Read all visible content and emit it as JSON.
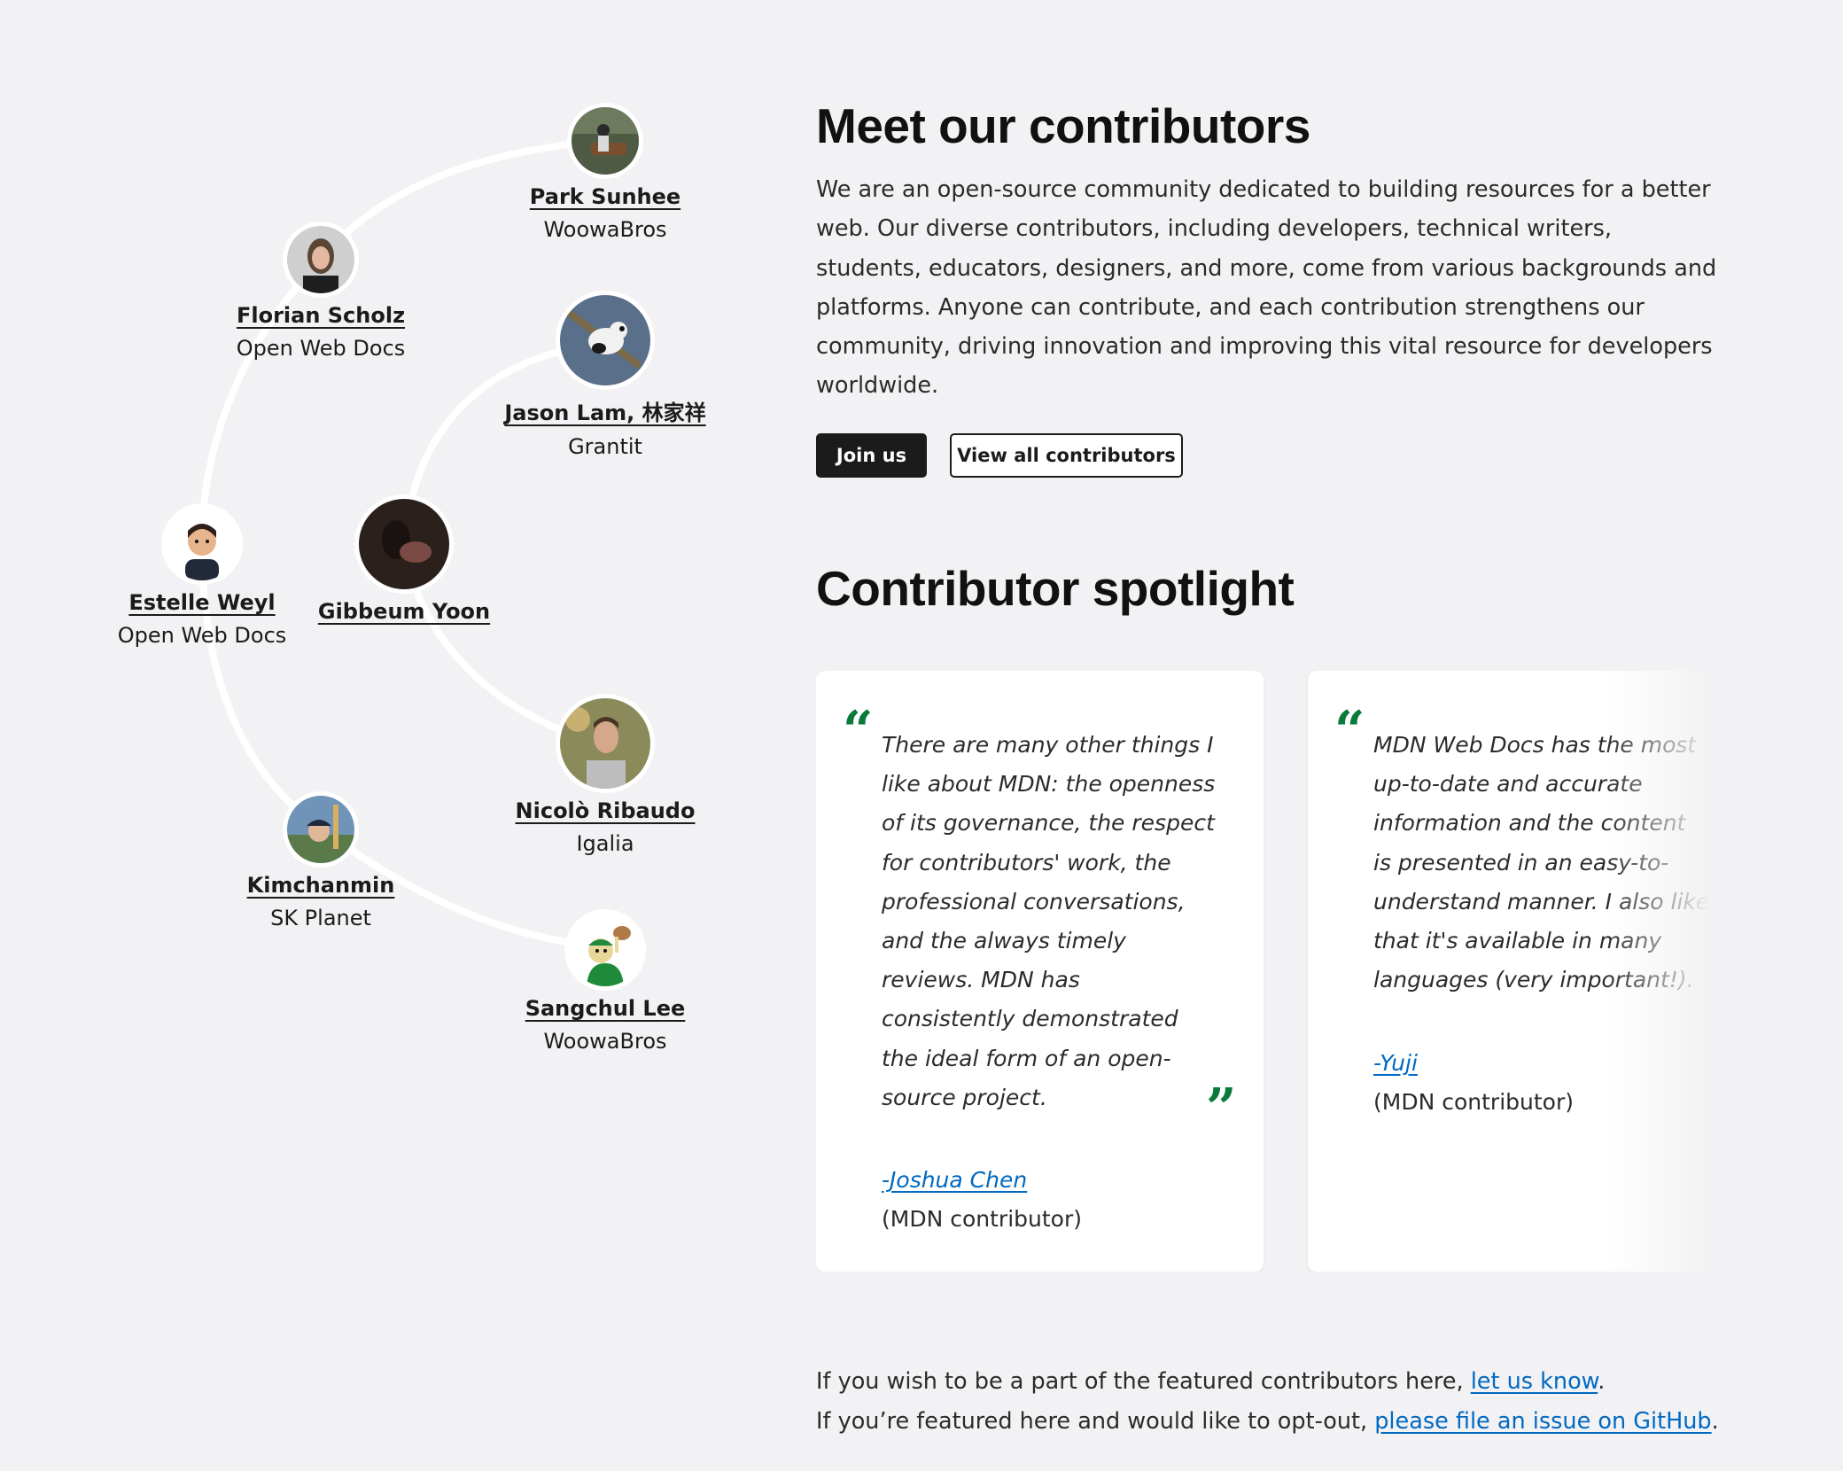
{
  "contributors": [
    {
      "name": "Park Sunhee",
      "org": "WoowaBros"
    },
    {
      "name": "Florian Scholz",
      "org": "Open Web Docs"
    },
    {
      "name": "Jason Lam, 林家祥",
      "org": "Grantit"
    },
    {
      "name": "Estelle Weyl",
      "org": "Open Web Docs"
    },
    {
      "name": "Gibbeum Yoon",
      "org": ""
    },
    {
      "name": "Nicolò Ribaudo",
      "org": "Igalia"
    },
    {
      "name": "Kimchanmin",
      "org": "SK Planet"
    },
    {
      "name": "Sangchul Lee",
      "org": "WoowaBros"
    }
  ],
  "intro": {
    "title": "Meet our contributors",
    "body": "We are an open-source community dedicated to building resources for a better web. Our diverse contributors, including developers, technical writers, students, educators, designers, and more, come from various backgrounds and platforms. Anyone can contribute, and each contribution strengthens our community, driving innovation and improving this vital resource for developers worldwide.",
    "join_label": "Join us",
    "view_all_label": "View all contributors"
  },
  "spotlight": {
    "title": "Contributor spotlight",
    "cards": [
      {
        "quote": "There are many other things I like about MDN: the openness of its governance, the respect for contributors' work, the professional conversations, and the always timely reviews. MDN has consistently demonstrated the ideal form of an open-source project.",
        "author": "-Joshua Chen",
        "role": "(MDN contributor)"
      },
      {
        "quote": "MDN Web Docs has the most up-to-date and accurate information and the content is presented in an easy-to-understand manner. I also like that it's available in many languages (very important!).",
        "author": "-Yuji",
        "role": "(MDN contributor)"
      }
    ]
  },
  "footer": {
    "line1_prefix": "If you wish to be a part of the featured contributors here, ",
    "line1_link": "let us know",
    "line1_suffix": ".",
    "line2_prefix": "If you’re featured here and would like to opt-out, ",
    "line2_link": "please file an issue on GitHub",
    "line2_suffix": "."
  },
  "colors": {
    "background": "#f2f2f4",
    "accent_green": "#0a7a3a",
    "link_blue": "#0069c2",
    "primary_button": "#1b1b1b"
  },
  "icons": {
    "quote_open": "“",
    "quote_close": "”"
  }
}
